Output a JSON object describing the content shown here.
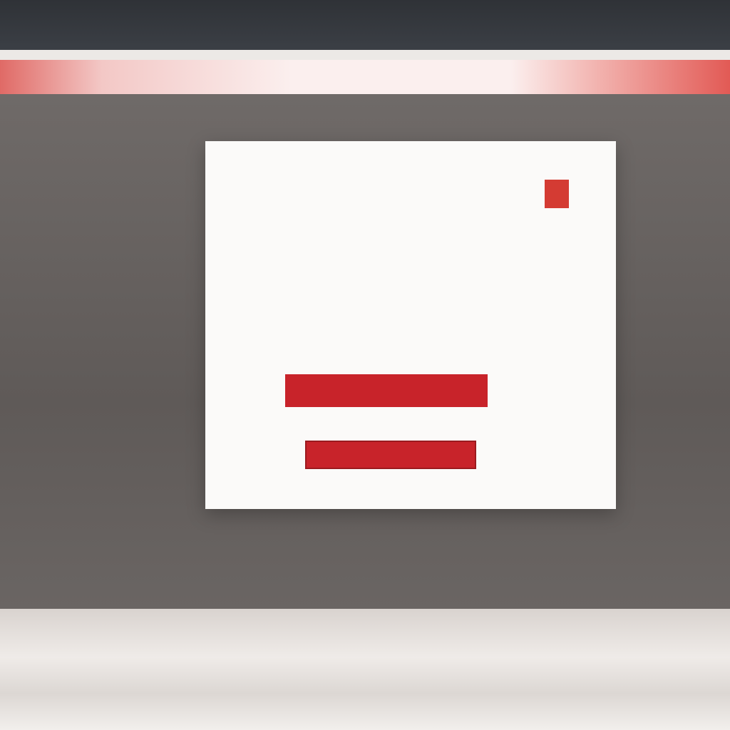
{
  "modal": {
    "tag": "",
    "title": "",
    "close_label": "",
    "line1": "",
    "line2": "",
    "line3": "",
    "note": "",
    "subnote": "",
    "primary_button": "",
    "secondary_button": "",
    "footer_link": ""
  },
  "colors": {
    "accent": "#c8232a",
    "topbar": "#2f3237",
    "overlay": "#6f6a68",
    "modal_bg": "#fbfaf9"
  }
}
